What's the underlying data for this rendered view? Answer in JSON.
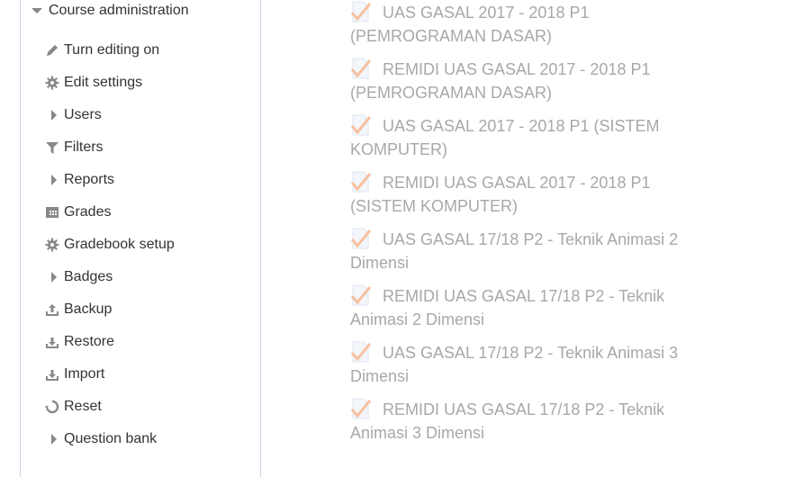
{
  "sidebar": {
    "header": "Course administration",
    "items": [
      {
        "label": "Turn editing on",
        "icon": "pencil-icon"
      },
      {
        "label": "Edit settings",
        "icon": "gear-icon"
      },
      {
        "label": "Users",
        "icon": "expand-arrow-icon"
      },
      {
        "label": "Filters",
        "icon": "filter-icon"
      },
      {
        "label": "Reports",
        "icon": "expand-arrow-icon"
      },
      {
        "label": "Grades",
        "icon": "table-icon"
      },
      {
        "label": "Gradebook setup",
        "icon": "gear-icon"
      },
      {
        "label": "Badges",
        "icon": "expand-arrow-icon"
      },
      {
        "label": "Backup",
        "icon": "upload-icon"
      },
      {
        "label": "Restore",
        "icon": "download-icon"
      },
      {
        "label": "Import",
        "icon": "download-icon"
      },
      {
        "label": "Reset",
        "icon": "refresh-icon"
      },
      {
        "label": "Question bank",
        "icon": "expand-arrow-icon"
      }
    ]
  },
  "quizzes": [
    {
      "title": "UAS GASAL 2017 - 2018 P1 (PEMROGRAMAN DASAR)",
      "icon": "quiz-icon"
    },
    {
      "title": "REMIDI UAS GASAL 2017 - 2018 P1 (PEMROGRAMAN DASAR)",
      "icon": "quiz-icon"
    },
    {
      "title": "UAS GASAL 2017 - 2018 P1 (SISTEM KOMPUTER)",
      "icon": "quiz-icon"
    },
    {
      "title": "REMIDI UAS GASAL 2017 - 2018 P1 (SISTEM KOMPUTER)",
      "icon": "quiz-icon"
    },
    {
      "title": "UAS GASAL 17/18 P2 - Teknik Animasi 2 Dimensi",
      "icon": "quiz-icon"
    },
    {
      "title": "REMIDI UAS GASAL 17/18 P2 - Teknik Animasi 2 Dimensi",
      "icon": "quiz-icon"
    },
    {
      "title": "UAS GASAL 17/18 P2 - Teknik Animasi 3 Dimensi",
      "icon": "quiz-icon"
    },
    {
      "title": "REMIDI UAS GASAL 17/18 P2 - Teknik Animasi 3 Dimensi",
      "icon": "quiz-icon"
    }
  ],
  "colors": {
    "quiz_check": "#f7b78f",
    "icon_gray": "#888888",
    "text": "#333333",
    "quiz_text": "#a8a8a8"
  }
}
